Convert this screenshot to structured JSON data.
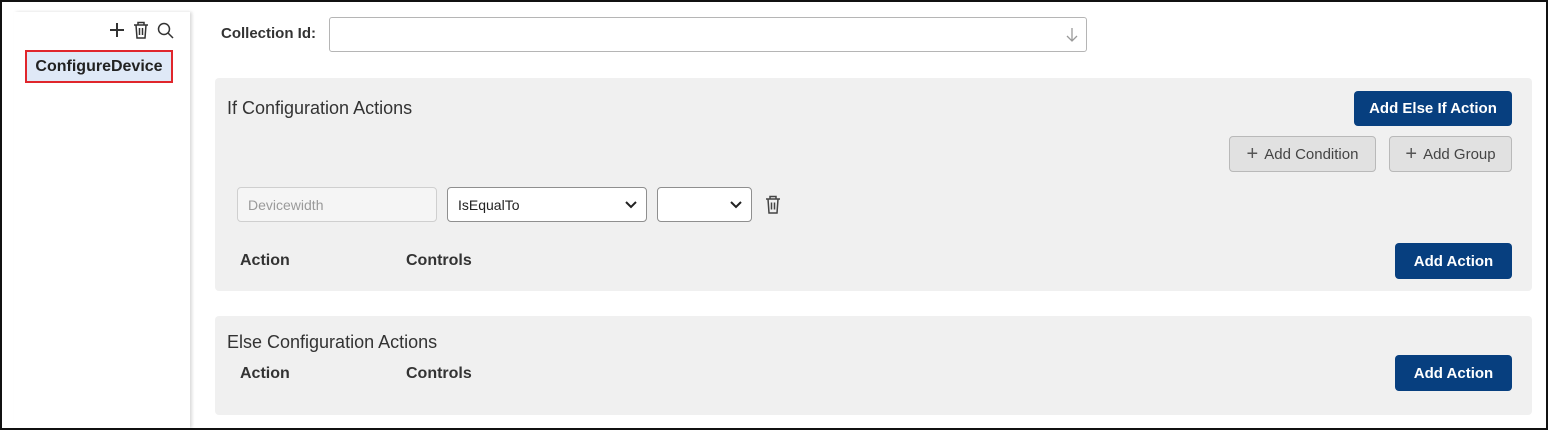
{
  "sidebar": {
    "tools": {
      "add_icon": "plus-icon",
      "delete_icon": "trash-icon",
      "search_icon": "search-icon"
    },
    "items": [
      {
        "label": "ConfigureDevice"
      }
    ]
  },
  "collection": {
    "label": "Collection Id:",
    "value": "",
    "arrow_icon": "arrow-down-icon"
  },
  "if_panel": {
    "title": "If Configuration Actions",
    "add_else_if_label": "Add Else If Action",
    "add_condition_label": "Add Condition",
    "add_group_label": "Add Group",
    "condition": {
      "field_placeholder": "Devicewidth",
      "operator": "IsEqualTo",
      "value": ""
    },
    "col_action": "Action",
    "col_controls": "Controls",
    "add_action_label": "Add Action"
  },
  "else_panel": {
    "title": "Else Configuration Actions",
    "col_action": "Action",
    "col_controls": "Controls",
    "add_action_label": "Add Action"
  },
  "colors": {
    "primary": "#073f7f",
    "panel_bg": "#f0f0f0",
    "highlight_border": "#e0262c",
    "selected_bg": "#dfe9f7"
  }
}
